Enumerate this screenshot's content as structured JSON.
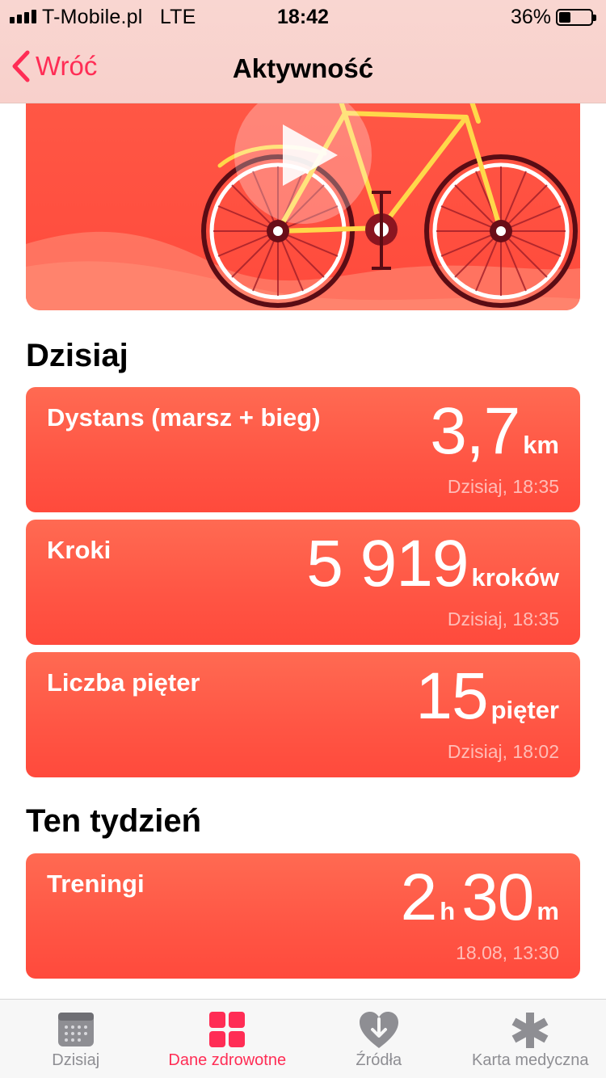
{
  "status_bar": {
    "carrier": "T-Mobile.pl",
    "network": "LTE",
    "time": "18:42",
    "battery": "36%",
    "battery_level": 0.36
  },
  "nav": {
    "back_label": "Wróć",
    "title": "Aktywność"
  },
  "hero": {
    "icon": "play-icon",
    "illustration": "bicycle"
  },
  "sections": {
    "today": "Dzisiaj",
    "week": "Ten tydzień"
  },
  "cards": [
    {
      "label": "Dystans (marsz + bieg)",
      "value": "3,7",
      "unit": "km",
      "time": "Dzisiaj, 18:35"
    },
    {
      "label": "Kroki",
      "value": "5 919",
      "unit": "kroków",
      "time": "Dzisiaj, 18:35"
    },
    {
      "label": "Liczba pięter",
      "value": "15",
      "unit": "pięter",
      "time": "Dzisiaj, 18:02"
    }
  ],
  "workouts": {
    "label": "Treningi",
    "hours": "2",
    "hours_unit": "h",
    "minutes": "30",
    "minutes_unit": "m",
    "time": "18.08, 13:30"
  },
  "tabs": [
    {
      "label": "Dzisiaj",
      "icon": "calendar-icon",
      "active": false
    },
    {
      "label": "Dane zdrowotne",
      "icon": "grid-icon",
      "active": true
    },
    {
      "label": "Źródła",
      "icon": "heart-download-icon",
      "active": false
    },
    {
      "label": "Karta medyczna",
      "icon": "asterisk-icon",
      "active": false
    }
  ],
  "colors": {
    "accent": "#ff2d55",
    "card": "#ff5544",
    "nav_bg": "#f8d0cb",
    "inactive": "#8e8e93"
  }
}
